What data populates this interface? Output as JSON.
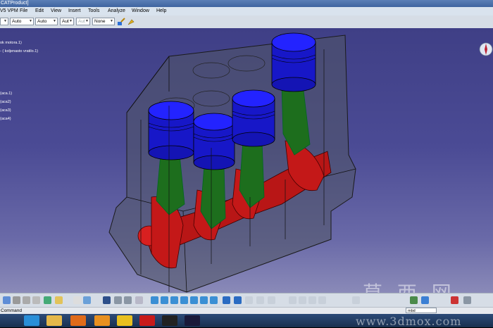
{
  "window": {
    "title": "CATProduct]"
  },
  "menu": {
    "app_label": "V5 VPM",
    "items": [
      "File",
      "Edit",
      "View",
      "Insert",
      "Tools",
      "Analyze",
      "Window",
      "Help"
    ]
  },
  "toolbar": {
    "combos": [
      {
        "value": "Auto",
        "disabled": false
      },
      {
        "value": "Auto",
        "disabled": false
      },
      {
        "value": "Aut",
        "disabled": false
      },
      {
        "value": "Aut",
        "disabled": true
      },
      {
        "value": "None",
        "disabled": false
      }
    ]
  },
  "tree": {
    "items": [
      "ok motora.1)",
      "- ( koljenasto vratilo.1)",
      "(aca.1)",
      "(aca2)",
      "(aca3)",
      "(aca4)"
    ]
  },
  "command": {
    "label": "Command",
    "input_value": "mbd"
  },
  "watermark": {
    "chars": "莫 西 网",
    "url": "www.3dmox.com"
  },
  "colors": {
    "viewport_top": "#3f3f86",
    "piston_blue": "#1a1ad8",
    "rod_green": "#1f7a1f",
    "crank_red": "#c81818",
    "block_gray": "#6f7380"
  }
}
